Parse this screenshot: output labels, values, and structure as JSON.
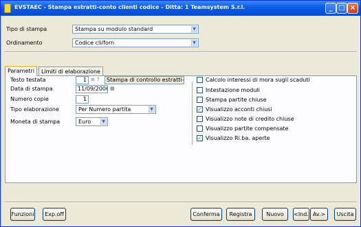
{
  "window": {
    "title": "EVSTAEC - Stampa estratti-conto clienti codice - Ditta: 1 Teamsystem S.r.l."
  },
  "form": {
    "tipo_stampa_label": "Tipo di stampa",
    "tipo_stampa_value": "Stampa su modulo standard",
    "ordinamento_label": "Ordinamento",
    "ordinamento_value": "Codice cli/forn"
  },
  "tabs": [
    {
      "label": "Parametri",
      "active": true
    },
    {
      "label": "Limiti di elaborazione",
      "active": false
    }
  ],
  "parametri": {
    "testo_testata_label": "Testo testata",
    "testo_testata_num": "1",
    "testo_testata_desc": "Stampa di controllo estratti-conti",
    "data_stampa_label": "Data di stampa",
    "data_stampa_value": "11/09/2006",
    "numero_copie_label": "Numero copie",
    "numero_copie_value": "1",
    "tipo_elaborazione_label": "Tipo elaborazione",
    "tipo_elaborazione_value": "Per Numero partita",
    "moneta_label": "Moneta di stampa",
    "moneta_value": "Euro"
  },
  "checkboxes": [
    {
      "label": "Calcolo interessi di mora sugli scaduti",
      "checked": false
    },
    {
      "label": "Intestazione moduli",
      "checked": false
    },
    {
      "label": "Stampa partite chiuse",
      "checked": false
    },
    {
      "label": "Visualizzo acconti chiusi",
      "checked": true
    },
    {
      "label": "Visualizzo note di credito chiuse",
      "checked": false
    },
    {
      "label": "Visualizzo partite compensate",
      "checked": false
    },
    {
      "label": "Visualizzo Ri.ba. aperte",
      "checked": true
    }
  ],
  "buttons": {
    "funzioni": "Funzioni",
    "expoff": "Exp.off",
    "conferma": "Conferma",
    "registra": "Registra",
    "nuovo": "Nuovo",
    "ind": "<Ind.",
    "av": "Av.>",
    "uscita": "Uscita"
  },
  "colors": {
    "titlebar": "#0a5ae8",
    "window_bg": "#ece9d8",
    "check_mark": "#21a121"
  }
}
